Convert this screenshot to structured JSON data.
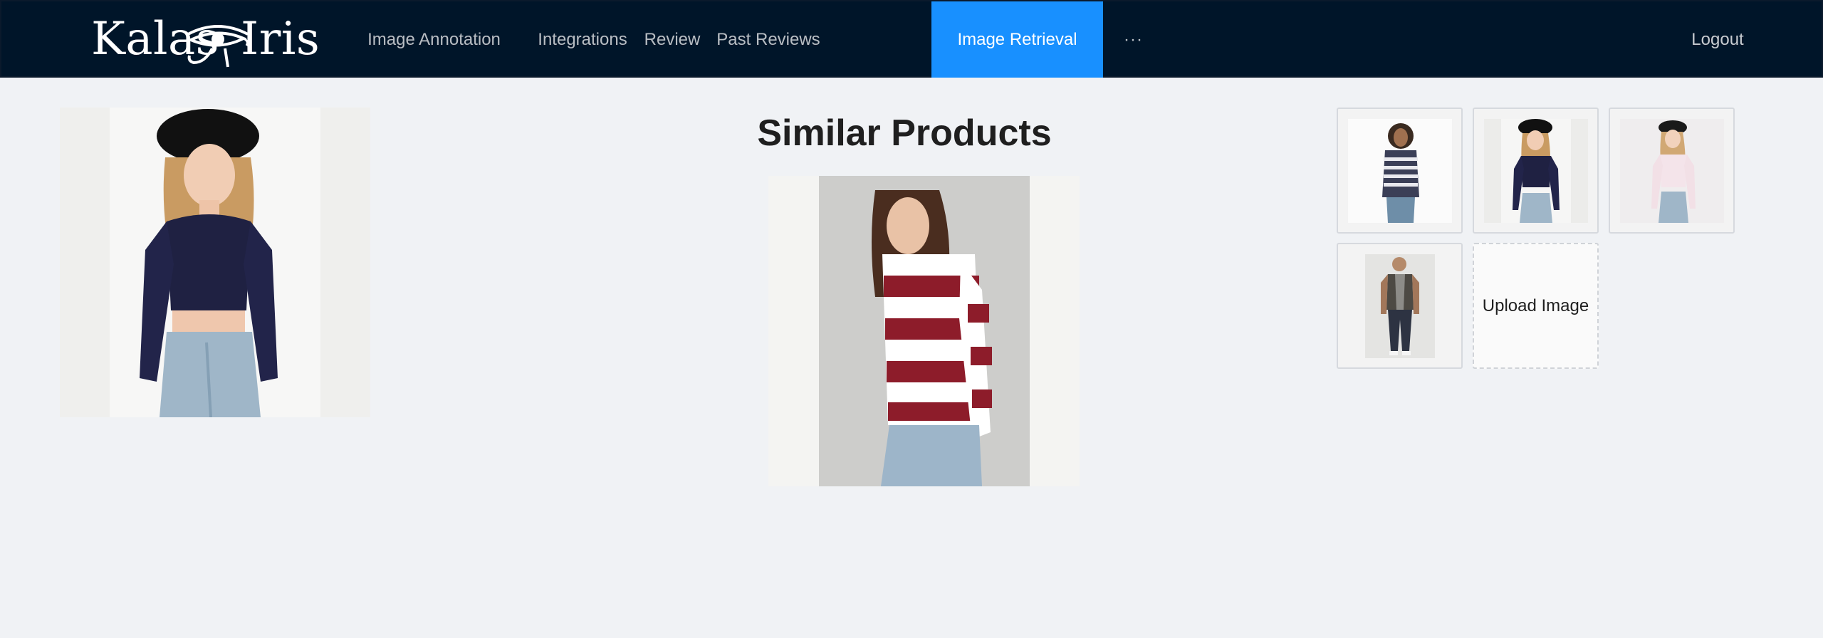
{
  "header": {
    "logo": {
      "left_text": "Kalas",
      "right_text": "Iris",
      "icon": "eye-of-horus-icon"
    },
    "nav": [
      {
        "label": "Image Annotation",
        "active": false
      },
      {
        "label": "Integrations",
        "active": false
      },
      {
        "label": "Review",
        "active": false
      },
      {
        "label": "Past Reviews",
        "active": false
      },
      {
        "label": "Image Retrieval",
        "active": true
      },
      {
        "label": "···",
        "active": false
      }
    ],
    "logout_label": "Logout"
  },
  "main": {
    "title": "Similar Products",
    "query_image": {
      "icon": "model-navy-lace-top-photo"
    },
    "result_image": {
      "icon": "model-red-white-striped-sweater-photo"
    }
  },
  "gallery": {
    "thumbnails": [
      {
        "icon": "model-striped-top-photo"
      },
      {
        "icon": "model-navy-lace-top-hat-photo"
      },
      {
        "icon": "model-white-top-hat-photo"
      },
      {
        "icon": "man-vest-photo"
      }
    ],
    "upload_label": "Upload Image"
  },
  "colors": {
    "header_bg": "#001529",
    "active_nav": "#1890ff",
    "page_bg": "#f0f2f5"
  }
}
